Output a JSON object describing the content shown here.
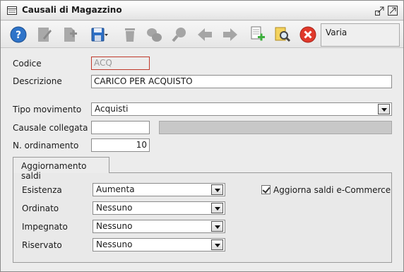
{
  "window": {
    "title": "Causali di Magazzino",
    "icons": [
      "window-icon",
      "restore-icon",
      "maximize-icon"
    ]
  },
  "toolbar": {
    "icons": [
      "help-icon",
      "edit-icon",
      "new-document-icon",
      "save-icon",
      "delete-icon",
      "tag-icon",
      "search-icon",
      "arrow-left-icon",
      "arrow-right-icon",
      "duplicate-icon",
      "find-icon",
      "close-icon"
    ],
    "varia_label": "Varia"
  },
  "form": {
    "codice_label": "Codice",
    "codice_value": "ACQ",
    "descrizione_label": "Descrizione",
    "descrizione_value": "CARICO PER ACQUISTO",
    "tipo_movimento_label": "Tipo movimento",
    "tipo_movimento_value": "Acquisti",
    "causale_collegata_label": "Causale collegata",
    "causale_collegata_value": "",
    "ordinamento_label": "N. ordinamento",
    "ordinamento_value": "10"
  },
  "saldi": {
    "tab_label": "Aggiornamento saldi",
    "esistenza_label": "Esistenza",
    "esistenza_value": "Aumenta",
    "ordinato_label": "Ordinato",
    "ordinato_value": "Nessuno",
    "impegnato_label": "Impegnato",
    "impegnato_value": "Nessuno",
    "riservato_label": "Riservato",
    "riservato_value": "Nessuno",
    "ecommerce_label": "Aggiorna saldi e-Commerce",
    "ecommerce_checked": true
  }
}
